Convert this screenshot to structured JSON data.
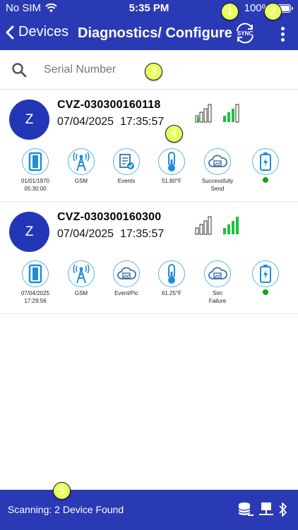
{
  "status_bar": {
    "carrier": "No SIM",
    "time": "5:35 PM",
    "battery": "100%"
  },
  "nav": {
    "back_label": "Devices",
    "title": "Diagnostics/ Configure",
    "sync_label": "SYNC"
  },
  "search": {
    "placeholder": "Serial Number"
  },
  "badges": [
    "1",
    "2",
    "3",
    "4",
    "5"
  ],
  "devices": [
    {
      "avatar": "Z",
      "serial": "CVZ-030300160118",
      "date": "07/04/2025",
      "time": "17:35:57",
      "icons": [
        {
          "icon": "door-sensor-icon",
          "label1": "01/01/1970",
          "label2": "05:30:00"
        },
        {
          "icon": "gsm-tower-icon",
          "label1": "GSM",
          "label2": ""
        },
        {
          "icon": "events-document-icon",
          "label1": "Events",
          "label2": ""
        },
        {
          "icon": "thermometer-icon",
          "label1": "51.80°F",
          "label2": ""
        },
        {
          "icon": "cloud-upload-icon",
          "label1": "Successfully",
          "label2": "Send"
        },
        {
          "icon": "battery-icon",
          "label1": "",
          "label2": ""
        }
      ]
    },
    {
      "avatar": "Z",
      "serial": "CVZ-030300160300",
      "date": "07/04/2025",
      "time": "17:35:57",
      "icons": [
        {
          "icon": "door-sensor-icon",
          "label1": "07/04/2025",
          "label2": "17:29:56"
        },
        {
          "icon": "gsm-tower-icon",
          "label1": "GSM",
          "label2": ""
        },
        {
          "icon": "cloud-image-icon",
          "label1": "Event/Pic",
          "label2": ""
        },
        {
          "icon": "thermometer-icon",
          "label1": "61.25°F",
          "label2": ""
        },
        {
          "icon": "cloud-image-icon",
          "label1": "Sim",
          "label2": "Failure"
        },
        {
          "icon": "battery-icon",
          "label1": "",
          "label2": ""
        }
      ]
    }
  ],
  "footer": {
    "scan_text": "Scanning: 2 Device Found"
  },
  "colors": {
    "brand_blue": "#2a3ab5",
    "avatar_blue": "#2336b6",
    "icon_ring": "#54b7e9",
    "signal_green": "#1cc23b",
    "status_dot": "#16a216"
  }
}
